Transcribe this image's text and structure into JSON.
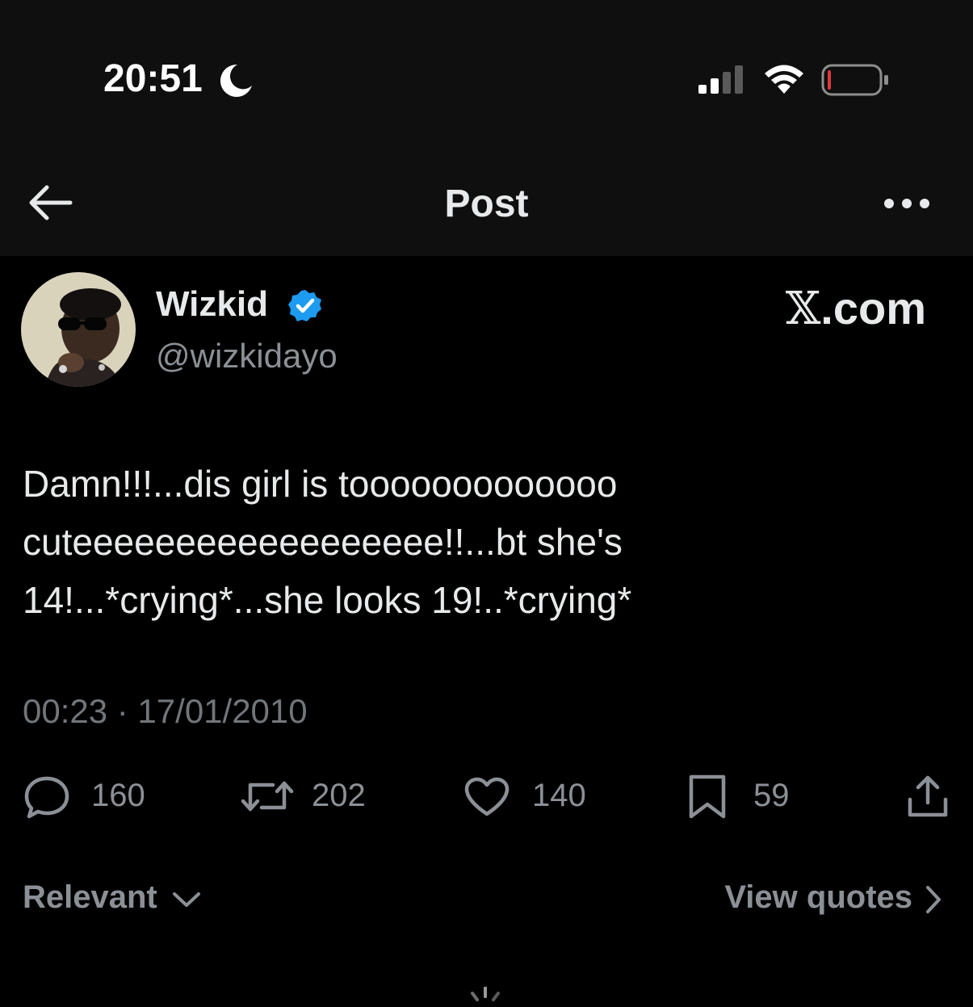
{
  "status_bar": {
    "time": "20:51",
    "moon_icon": "moon-icon",
    "signal_icon": "cellular-signal-icon",
    "wifi_icon": "wifi-icon",
    "battery_icon": "battery-low-icon",
    "battery_level": 0.05
  },
  "header": {
    "back_icon": "arrow-left-icon",
    "title": "Post",
    "more_icon": "more-horizontal-icon"
  },
  "post": {
    "author_name": "Wizkid",
    "verified_icon": "verified-badge-icon",
    "handle": "@wizkidayo",
    "watermark": "X.com",
    "watermark_mark": "𝕏",
    "watermark_suffix": ".com",
    "text_lines": [
      "Damn!!!...dis girl is tooooooooooooo",
      "cuteeeeeeeeeeeeeeeeee!!...bt she's",
      "14!...*crying*...she looks 19!..*crying*"
    ],
    "timestamp": "00:23 · 17/01/2010"
  },
  "actions": {
    "replies": "160",
    "reposts": "202",
    "likes": "140",
    "bookmarks": "59",
    "share_icon": "share-icon"
  },
  "footer": {
    "sort_label": "Relevant",
    "view_quotes_label": "View quotes"
  },
  "colors": {
    "background": "#000000",
    "header_background": "#0f0f0f",
    "verified_blue": "#1d9bf0",
    "battery_red": "#e0383e",
    "muted_text": "#71767b"
  }
}
